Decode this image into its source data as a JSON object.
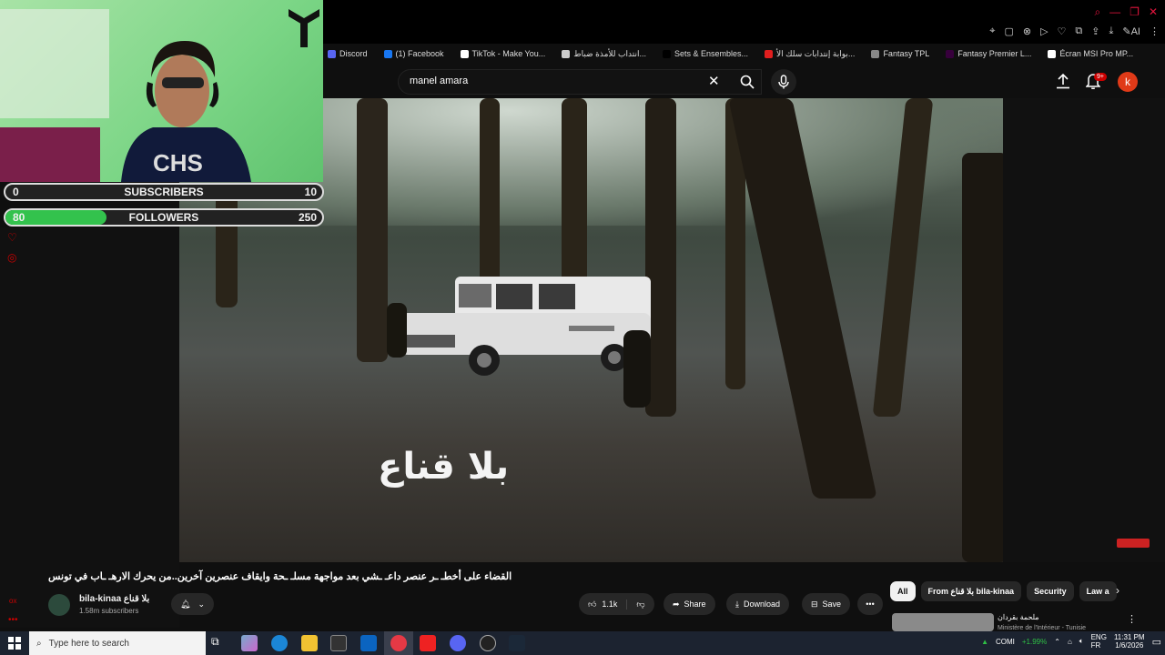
{
  "bookmarks": [
    {
      "label": "Discord",
      "color": "#5865f2"
    },
    {
      "label": "(1) Facebook",
      "color": "#1877f2"
    },
    {
      "label": "TikTok - Make You...",
      "color": "#ffffff"
    },
    {
      "label": "انتداب للأمذة ضباط...",
      "color": "#cccccc"
    },
    {
      "label": "Sets & Ensembles...",
      "color": "#000000"
    },
    {
      "label": "بوابة إنتدابات سلك الأ...",
      "color": "#e01e1e"
    },
    {
      "label": "Fantasy TPL",
      "color": "#888888"
    },
    {
      "label": "Fantasy Premier L...",
      "color": "#37003c"
    },
    {
      "label": "Écran MSI Pro MP...",
      "color": "#ffffff"
    }
  ],
  "header": {
    "search_value": "manel amara",
    "notification_badge": "9+",
    "avatar_letter": "k"
  },
  "video": {
    "overlay_text": "بلا قناع",
    "title": "القضاء على أخطـ ـر عنصر داعـ ـشي بعد مواجهة مسلـ ـحة وايقاف عنصرين آخرين..من يحرك الارهـ ـاب في تونس"
  },
  "stream_overlay": {
    "subscribers": {
      "label": "SUBSCRIBERS",
      "current": "0",
      "goal": "10",
      "progress": 0
    },
    "followers": {
      "label": "FOLLOWERS",
      "current": "80",
      "goal": "250",
      "progress": 0.32
    }
  },
  "channel": {
    "name": "bila-kinaa بلا قناع",
    "subscribers": "1.58m subscribers"
  },
  "actions": {
    "like_count": "1.1k",
    "share": "Share",
    "download": "Download",
    "save": "Save"
  },
  "chips": [
    "All",
    "From بلا قناع bila-kinaa",
    "Security",
    "Law a"
  ],
  "recommendation": {
    "title": "ملحمة بقردان",
    "subtitle": "Ministère de l'Intérieur - Tunisie"
  },
  "taskbar": {
    "search_placeholder": "Type here to search",
    "stock": "COMI",
    "stock_change": "+1.99%",
    "lang_top": "ENG",
    "lang_bottom": "FR",
    "time": "11:31 PM",
    "date": "1/6/2026"
  },
  "colors": {
    "accent_red": "#cc0000",
    "progress_green": "#33c24d",
    "taskbar": "#1c2330"
  }
}
